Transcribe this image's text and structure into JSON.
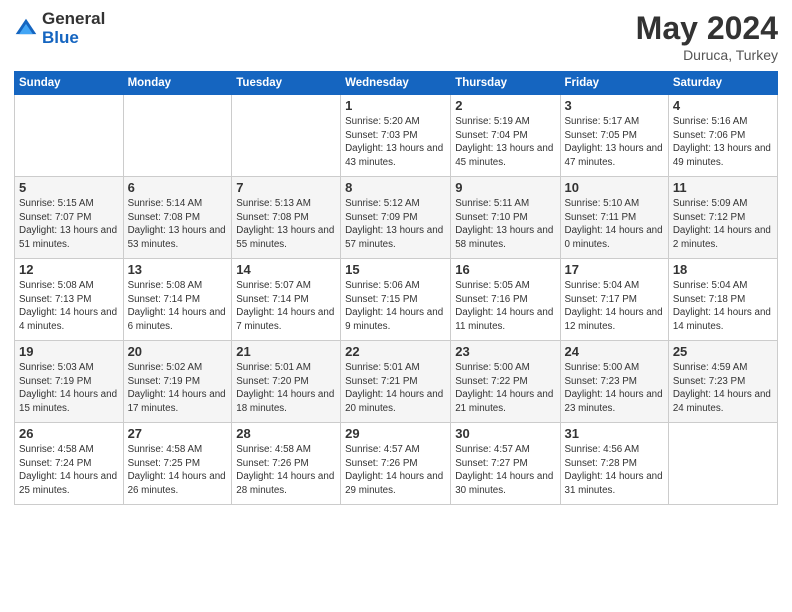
{
  "header": {
    "logo_general": "General",
    "logo_blue": "Blue",
    "month_year": "May 2024",
    "location": "Duruca, Turkey"
  },
  "weekdays": [
    "Sunday",
    "Monday",
    "Tuesday",
    "Wednesday",
    "Thursday",
    "Friday",
    "Saturday"
  ],
  "weeks": [
    [
      {
        "day": "",
        "info": ""
      },
      {
        "day": "",
        "info": ""
      },
      {
        "day": "",
        "info": ""
      },
      {
        "day": "1",
        "info": "Sunrise: 5:20 AM\nSunset: 7:03 PM\nDaylight: 13 hours\nand 43 minutes."
      },
      {
        "day": "2",
        "info": "Sunrise: 5:19 AM\nSunset: 7:04 PM\nDaylight: 13 hours\nand 45 minutes."
      },
      {
        "day": "3",
        "info": "Sunrise: 5:17 AM\nSunset: 7:05 PM\nDaylight: 13 hours\nand 47 minutes."
      },
      {
        "day": "4",
        "info": "Sunrise: 5:16 AM\nSunset: 7:06 PM\nDaylight: 13 hours\nand 49 minutes."
      }
    ],
    [
      {
        "day": "5",
        "info": "Sunrise: 5:15 AM\nSunset: 7:07 PM\nDaylight: 13 hours\nand 51 minutes."
      },
      {
        "day": "6",
        "info": "Sunrise: 5:14 AM\nSunset: 7:08 PM\nDaylight: 13 hours\nand 53 minutes."
      },
      {
        "day": "7",
        "info": "Sunrise: 5:13 AM\nSunset: 7:08 PM\nDaylight: 13 hours\nand 55 minutes."
      },
      {
        "day": "8",
        "info": "Sunrise: 5:12 AM\nSunset: 7:09 PM\nDaylight: 13 hours\nand 57 minutes."
      },
      {
        "day": "9",
        "info": "Sunrise: 5:11 AM\nSunset: 7:10 PM\nDaylight: 13 hours\nand 58 minutes."
      },
      {
        "day": "10",
        "info": "Sunrise: 5:10 AM\nSunset: 7:11 PM\nDaylight: 14 hours\nand 0 minutes."
      },
      {
        "day": "11",
        "info": "Sunrise: 5:09 AM\nSunset: 7:12 PM\nDaylight: 14 hours\nand 2 minutes."
      }
    ],
    [
      {
        "day": "12",
        "info": "Sunrise: 5:08 AM\nSunset: 7:13 PM\nDaylight: 14 hours\nand 4 minutes."
      },
      {
        "day": "13",
        "info": "Sunrise: 5:08 AM\nSunset: 7:14 PM\nDaylight: 14 hours\nand 6 minutes."
      },
      {
        "day": "14",
        "info": "Sunrise: 5:07 AM\nSunset: 7:14 PM\nDaylight: 14 hours\nand 7 minutes."
      },
      {
        "day": "15",
        "info": "Sunrise: 5:06 AM\nSunset: 7:15 PM\nDaylight: 14 hours\nand 9 minutes."
      },
      {
        "day": "16",
        "info": "Sunrise: 5:05 AM\nSunset: 7:16 PM\nDaylight: 14 hours\nand 11 minutes."
      },
      {
        "day": "17",
        "info": "Sunrise: 5:04 AM\nSunset: 7:17 PM\nDaylight: 14 hours\nand 12 minutes."
      },
      {
        "day": "18",
        "info": "Sunrise: 5:04 AM\nSunset: 7:18 PM\nDaylight: 14 hours\nand 14 minutes."
      }
    ],
    [
      {
        "day": "19",
        "info": "Sunrise: 5:03 AM\nSunset: 7:19 PM\nDaylight: 14 hours\nand 15 minutes."
      },
      {
        "day": "20",
        "info": "Sunrise: 5:02 AM\nSunset: 7:19 PM\nDaylight: 14 hours\nand 17 minutes."
      },
      {
        "day": "21",
        "info": "Sunrise: 5:01 AM\nSunset: 7:20 PM\nDaylight: 14 hours\nand 18 minutes."
      },
      {
        "day": "22",
        "info": "Sunrise: 5:01 AM\nSunset: 7:21 PM\nDaylight: 14 hours\nand 20 minutes."
      },
      {
        "day": "23",
        "info": "Sunrise: 5:00 AM\nSunset: 7:22 PM\nDaylight: 14 hours\nand 21 minutes."
      },
      {
        "day": "24",
        "info": "Sunrise: 5:00 AM\nSunset: 7:23 PM\nDaylight: 14 hours\nand 23 minutes."
      },
      {
        "day": "25",
        "info": "Sunrise: 4:59 AM\nSunset: 7:23 PM\nDaylight: 14 hours\nand 24 minutes."
      }
    ],
    [
      {
        "day": "26",
        "info": "Sunrise: 4:58 AM\nSunset: 7:24 PM\nDaylight: 14 hours\nand 25 minutes."
      },
      {
        "day": "27",
        "info": "Sunrise: 4:58 AM\nSunset: 7:25 PM\nDaylight: 14 hours\nand 26 minutes."
      },
      {
        "day": "28",
        "info": "Sunrise: 4:58 AM\nSunset: 7:26 PM\nDaylight: 14 hours\nand 28 minutes."
      },
      {
        "day": "29",
        "info": "Sunrise: 4:57 AM\nSunset: 7:26 PM\nDaylight: 14 hours\nand 29 minutes."
      },
      {
        "day": "30",
        "info": "Sunrise: 4:57 AM\nSunset: 7:27 PM\nDaylight: 14 hours\nand 30 minutes."
      },
      {
        "day": "31",
        "info": "Sunrise: 4:56 AM\nSunset: 7:28 PM\nDaylight: 14 hours\nand 31 minutes."
      },
      {
        "day": "",
        "info": ""
      }
    ]
  ]
}
